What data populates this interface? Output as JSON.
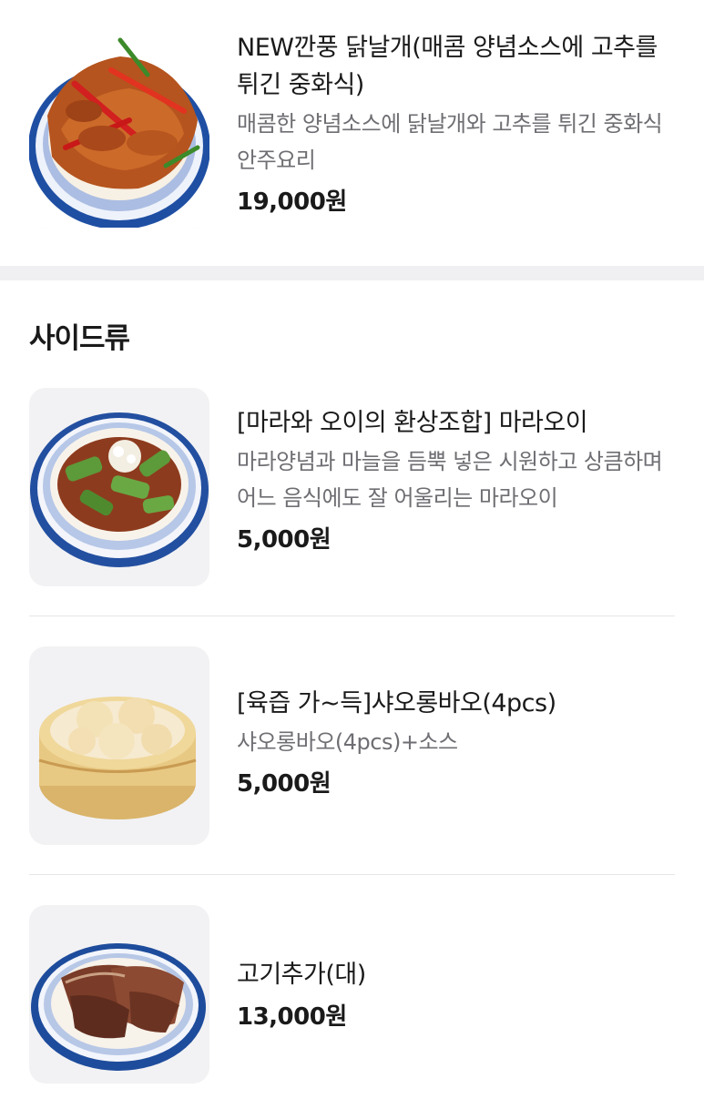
{
  "items_top": [
    {
      "name": "NEW깐풍 닭날개(매콤 양념소스에 고추를 튀긴 중화식)",
      "description": "매콤한 양념소스에 닭날개와 고추를 튀긴 중화식 안주요리",
      "price": "19,000원",
      "image": "spicy-chicken-wings-dish"
    }
  ],
  "side_section": {
    "title": "사이드류",
    "items": [
      {
        "name": "[마라와 오이의 환상조합] 마라오이",
        "description": "마라양념과 마늘을 듬뿍 넣은 시원하고 상큼하며 어느 음식에도 잘 어울리는 마라오이",
        "price": "5,000원",
        "image": "mala-cucumber-dish"
      },
      {
        "name": "[육즙 가~득]샤오롱바오(4pcs)",
        "description": "샤오롱바오(4pcs)+소스",
        "price": "5,000원",
        "image": "xiaolongbao-steamer"
      },
      {
        "name": "고기추가(대)",
        "price": "13,000원",
        "image": "sliced-beef-plate"
      }
    ]
  }
}
